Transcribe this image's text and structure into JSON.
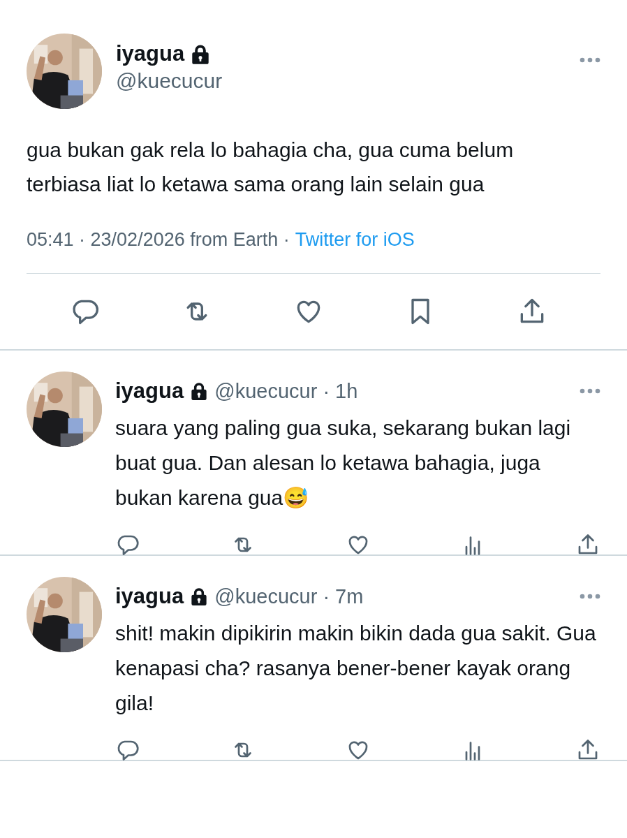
{
  "main_tweet": {
    "author": {
      "name": "iyagua",
      "handle": "@kuecucur",
      "protected": true
    },
    "text": "gua bukan gak rela lo bahagia cha, gua cuma belum terbiasa liat lo ketawa sama orang lain selain gua",
    "timestamp": "05:41 · 23/02/2026 from Earth ·",
    "source": "Twitter for iOS",
    "actions": [
      {
        "kind": "reply"
      },
      {
        "kind": "retweet"
      },
      {
        "kind": "like"
      },
      {
        "kind": "bookmark"
      },
      {
        "kind": "share"
      }
    ]
  },
  "replies": [
    {
      "author": {
        "name": "iyagua",
        "protected": true
      },
      "meta": "@kuecucur · 1h",
      "text": "suara yang paling gua suka, sekarang bukan lagi buat gua. Dan alesan lo ketawa bahagia, juga bukan karena gua😅",
      "actions": [
        {
          "kind": "reply"
        },
        {
          "kind": "retweet"
        },
        {
          "kind": "like"
        },
        {
          "kind": "views"
        },
        {
          "kind": "share"
        }
      ]
    },
    {
      "author": {
        "name": "iyagua",
        "protected": true
      },
      "meta": "@kuecucur · 7m",
      "text": "shit! makin dipikirin makin bikin dada gua sakit. Gua kenapasi cha? rasanya bener-bener kayak orang gila!",
      "actions": [
        {
          "kind": "reply"
        },
        {
          "kind": "retweet"
        },
        {
          "kind": "like"
        },
        {
          "kind": "views"
        },
        {
          "kind": "share"
        }
      ]
    }
  ]
}
